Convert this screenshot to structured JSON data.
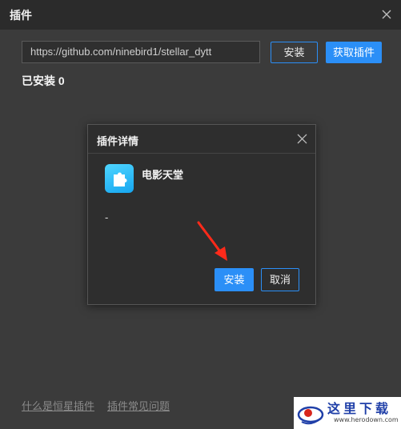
{
  "window": {
    "title": "插件"
  },
  "main": {
    "url_value": "https://github.com/ninebird1/stellar_dytt",
    "install_label": "安装",
    "get_plugin_label": "获取插件",
    "installed_count": "已安装 0"
  },
  "dialog": {
    "title": "插件详情",
    "plugin_name": "电影天堂",
    "plugin_description": "-",
    "install_label": "安装",
    "cancel_label": "取消"
  },
  "footer": {
    "link_what": "什么是恒星插件",
    "link_faq": "插件常见问题"
  },
  "watermark": {
    "text": "这里下载",
    "url": "www.herodown.com"
  },
  "colors": {
    "accent": "#2b8ff7",
    "background": "#3b3b3b",
    "titlebar": "#2b2b2b",
    "dialog": "#2e2e2e",
    "arrow": "#ff2a1a"
  }
}
